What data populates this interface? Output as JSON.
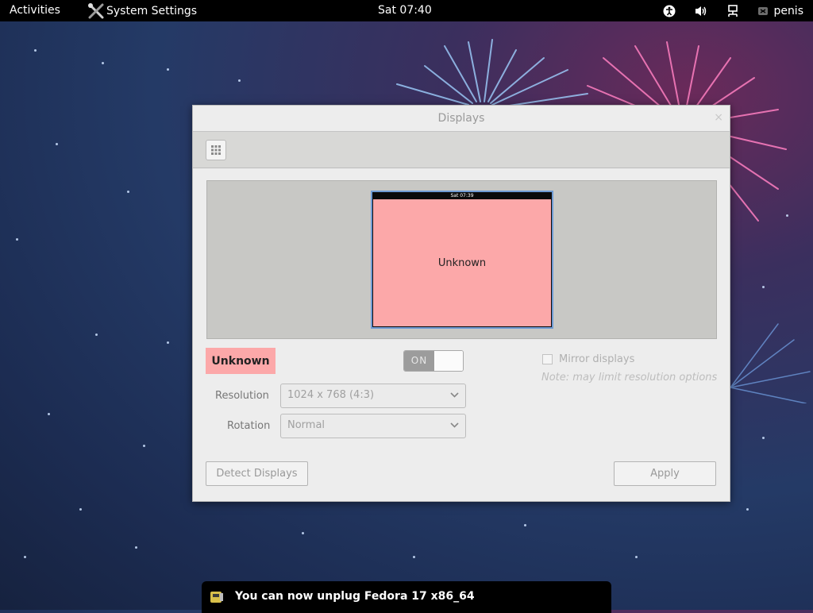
{
  "topbar": {
    "activities": "Activities",
    "app_name": "System Settings",
    "clock": "Sat 07:40",
    "user": "penis"
  },
  "window": {
    "title": "Displays",
    "close_glyph": "×",
    "preview": {
      "monitor_clock": "Sat 07:39",
      "monitor_label": "Unknown"
    },
    "display_name": "Unknown",
    "switch_label": "ON",
    "mirror_label": "Mirror displays",
    "note": "Note: may limit resolution options",
    "resolution_label": "Resolution",
    "resolution_value": "1024 x 768 (4:3)",
    "rotation_label": "Rotation",
    "rotation_value": "Normal",
    "detect_button": "Detect Displays",
    "apply_button": "Apply"
  },
  "notification": {
    "text": "You can now unplug Fedora 17 x86_64"
  },
  "colors": {
    "monitor_fill": "#fca8a9",
    "topbar": "#000000",
    "window_bg": "#ededed"
  },
  "icons": {
    "app": "tools-icon",
    "accessibility": "accessibility-icon",
    "volume": "volume-icon",
    "network": "network-icon",
    "user_status": "user-status-icon",
    "grid": "grid-icon",
    "notification": "usb-drive-icon"
  }
}
